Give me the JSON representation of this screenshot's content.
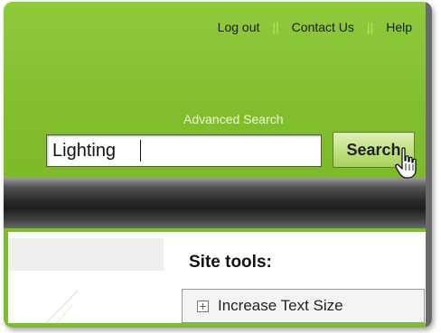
{
  "header": {
    "links": [
      {
        "label": "Log out"
      },
      {
        "label": "Contact Us"
      },
      {
        "label": "Help"
      }
    ],
    "separator": "||"
  },
  "search": {
    "advanced_label": "Advanced Search",
    "value": "Lighting",
    "button_label": "Search"
  },
  "sidebar": {
    "title": "Site tools:",
    "items": [
      {
        "label": "Increase Text Size",
        "icon": "plus-box-icon"
      }
    ]
  },
  "colors": {
    "header_green": "#82bf2f",
    "band_dark": "#1e1e1e",
    "button_green": "#bfe07f"
  }
}
